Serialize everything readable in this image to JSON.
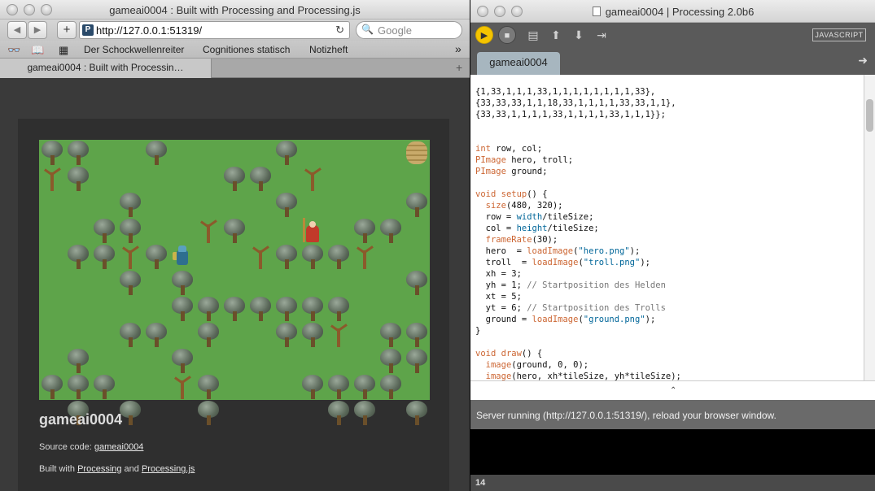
{
  "browser": {
    "title": "gameai0004 : Built with Processing and Processing.js",
    "url": "http://127.0.0.1:51319/",
    "search_placeholder": "Google",
    "bookmarks": [
      "Der Schockwellenreiter",
      "Cognitiones statisch",
      "Notizheft"
    ],
    "tab_label": "gameai0004 : Built with Processin…",
    "add_label": "+",
    "new_tab_label": "+",
    "more_label": "»"
  },
  "page": {
    "heading": "gameai0004",
    "source_prefix": "Source code: ",
    "source_link": "gameai0004",
    "built_prefix": "Built with ",
    "link1": "Processing",
    "and": " and ",
    "link2": "Processing.js"
  },
  "game": {
    "trees": [
      [
        0,
        0
      ],
      [
        1,
        0
      ],
      [
        4,
        0
      ],
      [
        9,
        0
      ],
      [
        7,
        1
      ],
      [
        8,
        1
      ],
      [
        1,
        1
      ],
      [
        3,
        2
      ],
      [
        9,
        2
      ],
      [
        3,
        3
      ],
      [
        12,
        3
      ],
      [
        13,
        3
      ],
      [
        14,
        2
      ],
      [
        4,
        4
      ],
      [
        1,
        4
      ],
      [
        2,
        4
      ],
      [
        9,
        4
      ],
      [
        10,
        4
      ],
      [
        11,
        4
      ],
      [
        5,
        5
      ],
      [
        14,
        5
      ],
      [
        5,
        6
      ],
      [
        6,
        6
      ],
      [
        7,
        6
      ],
      [
        8,
        6
      ],
      [
        9,
        6
      ],
      [
        10,
        6
      ],
      [
        11,
        6
      ],
      [
        3,
        7
      ],
      [
        4,
        7
      ],
      [
        6,
        7
      ],
      [
        9,
        7
      ],
      [
        10,
        7
      ],
      [
        13,
        7
      ],
      [
        14,
        7
      ],
      [
        1,
        8
      ],
      [
        5,
        8
      ],
      [
        13,
        8
      ],
      [
        14,
        8
      ],
      [
        0,
        9
      ],
      [
        1,
        9
      ],
      [
        2,
        9
      ],
      [
        6,
        9
      ],
      [
        10,
        9
      ],
      [
        11,
        9
      ],
      [
        12,
        9
      ],
      [
        13,
        9
      ],
      [
        1,
        10
      ],
      [
        3,
        10
      ],
      [
        6,
        10
      ],
      [
        11,
        10
      ],
      [
        12,
        10
      ],
      [
        14,
        10
      ],
      [
        7,
        3
      ],
      [
        2,
        3
      ],
      [
        3,
        5
      ]
    ],
    "dead_trees": [
      [
        0,
        1
      ],
      [
        10,
        1
      ],
      [
        6,
        3
      ],
      [
        3,
        4
      ],
      [
        12,
        4
      ],
      [
        8,
        4
      ],
      [
        3,
        5
      ],
      [
        10,
        6
      ],
      [
        11,
        7
      ],
      [
        5,
        9
      ]
    ],
    "hero": [
      5,
      4
    ],
    "troll": [
      10,
      3
    ],
    "rock": [
      14,
      0
    ]
  },
  "ide": {
    "title": "gameai0004 | Processing 2.0b6",
    "mode": "JAVASCRIPT",
    "tab": "gameai0004",
    "status": "Server running (http://127.0.0.1:51319/), reload your browser window.",
    "line_number": "14",
    "toolbar_icons": [
      "run-icon",
      "stop-icon",
      "new-icon",
      "open-icon",
      "save-icon",
      "export-icon"
    ]
  }
}
